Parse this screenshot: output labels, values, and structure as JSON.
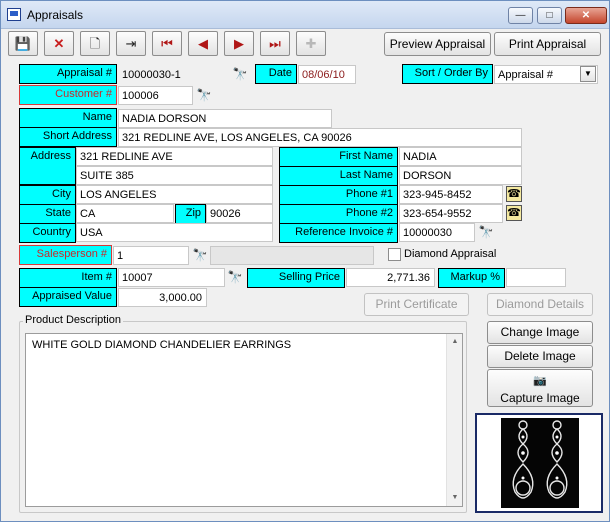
{
  "window": {
    "title": "Appraisals",
    "minimize": "—",
    "maximize": "□",
    "close": "✕"
  },
  "toolbar": {
    "preview_label": "Preview Appraisal",
    "print_label": "Print Appraisal",
    "icons": [
      "save-icon",
      "delete-icon",
      "new-icon",
      "exit-icon",
      "first-icon",
      "previous-icon",
      "next-icon",
      "last-icon",
      "add-icon"
    ]
  },
  "form": {
    "appraisal_no_label": "Appraisal #",
    "appraisal_no": "10000030-1",
    "date_label": "Date",
    "date": "08/06/10",
    "sort_label": "Sort / Order By",
    "sort_value": "Appraisal #",
    "customer_label": "Customer #",
    "customer_no": "100006",
    "name_label": "Name",
    "name": "NADIA DORSON",
    "short_address_label": "Short Address",
    "short_address": "321 REDLINE AVE, LOS ANGELES, CA 90026",
    "address_label": "Address",
    "address1": "321 REDLINE AVE",
    "address2": "SUITE 385",
    "city_label": "City",
    "city": "LOS ANGELES",
    "state_label": "State",
    "state": "CA",
    "zip_label": "Zip",
    "zip": "90026",
    "country_label": "Country",
    "country": "USA",
    "first_name_label": "First Name",
    "first_name": "NADIA",
    "last_name_label": "Last Name",
    "last_name": "DORSON",
    "phone1_label": "Phone #1",
    "phone1": "323-945-8452",
    "phone2_label": "Phone #2",
    "phone2": "323-654-9552",
    "ref_invoice_label": "Reference Invoice #",
    "ref_invoice": "10000030",
    "salesperson_label": "Salesperson #",
    "salesperson": "1",
    "diamond_appraisal_label": "Diamond Appraisal",
    "item_label": "Item #",
    "item_no": "10007",
    "selling_price_label": "Selling Price",
    "selling_price": "2,771.36",
    "markup_label": "Markup %",
    "markup": "",
    "appraised_value_label": "Appraised Value",
    "appraised_value": "3,000.00"
  },
  "buttons": {
    "print_certificate": "Print Certificate",
    "diamond_details": "Diamond Details",
    "change_image": "Change Image",
    "delete_image": "Delete Image",
    "capture_image": "Capture Image"
  },
  "description": {
    "title": "Product Description",
    "text": "WHITE GOLD DIAMOND CHANDELIER EARRINGS"
  },
  "colors": {
    "label_bg": "#00ffff",
    "required_label_text": "#c8282a",
    "image_border": "#1a2a66"
  }
}
